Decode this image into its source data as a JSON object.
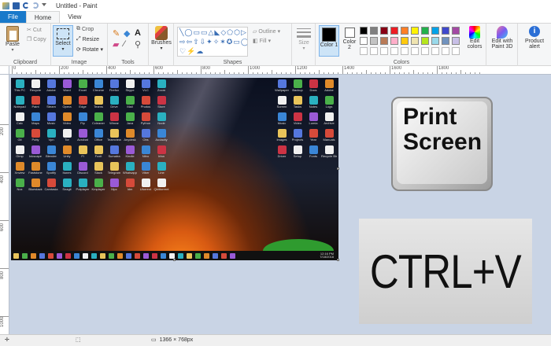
{
  "window": {
    "title": "Untitled - Paint"
  },
  "tabs": [
    "File",
    "Home",
    "View"
  ],
  "clipboard": {
    "paste": "Paste",
    "cut": "Cut",
    "copy": "Copy",
    "label": "Clipboard"
  },
  "image": {
    "select": "Select",
    "crop": "Crop",
    "resize": "Resize",
    "rotate": "Rotate",
    "label": "Image"
  },
  "tools": {
    "label": "Tools"
  },
  "brushes": {
    "label": "Brushes"
  },
  "shapes": {
    "outline": "Outline",
    "fill": "Fill",
    "label": "Shapes"
  },
  "size": {
    "label": "Size"
  },
  "colors": {
    "color1": "Color 1",
    "color2": "Color 2",
    "label": "Colors",
    "edit_colors": "Edit colors",
    "palette_row1": [
      "#000000",
      "#7f7f7f",
      "#880015",
      "#ed1c24",
      "#ff7f27",
      "#fff200",
      "#22b14c",
      "#00a2e8",
      "#3f48cc",
      "#a349a4"
    ],
    "palette_row2": [
      "#ffffff",
      "#c3c3c3",
      "#b97a57",
      "#ffaec9",
      "#ffc90e",
      "#efe4b0",
      "#b5e61d",
      "#99d9ea",
      "#7092be",
      "#c8bfe7"
    ],
    "color1_value": "#000000",
    "color2_value": "#ffffff"
  },
  "paint3d": {
    "label": "Edit with Paint 3D"
  },
  "product_alert": {
    "label": "Product alert"
  },
  "ruler": {
    "top": [
      "0",
      "200",
      "400",
      "600",
      "800",
      "1000",
      "1200",
      "1400",
      "1600",
      "1800"
    ],
    "left": [
      "200",
      "400",
      "600",
      "800",
      "1000"
    ]
  },
  "desktop": {
    "left_icons": [
      "This PC",
      "Recycle",
      "Adobe",
      "Word",
      "Excel",
      "Chrome",
      "Firefox",
      "Skype",
      "VLC",
      "Zoom",
      "Notepad",
      "Paint",
      "Steam",
      "Opera",
      "Edge",
      "Teams",
      "Drive",
      "Mail",
      "Photos",
      "Store",
      "Calc",
      "Maps",
      "Music",
      "Video",
      "Ftp",
      "Ccleaner",
      "Winrar",
      "Java",
      "Python",
      "Node",
      "Git",
      "Putty",
      "Vpn",
      "Tor",
      "Acrobat",
      "Office",
      "Teamview",
      "Anydesk",
      "Obs",
      "Audacity",
      "Gimp",
      "Inkscape",
      "Blender",
      "Unity",
      "Fl",
      "Foxit",
      "Sumatra",
      "Kindle",
      "Nitro",
      "Irfan",
      "Xnview",
      "Faststone",
      "Spotify",
      "Itunes",
      "Discord",
      "Slack",
      "Telegram",
      "Whatsapp",
      "Viber",
      "Line",
      "Nox",
      "Bluestack",
      "Camtasia",
      "Snagit",
      "Potplayer",
      "Kmplayer",
      "Mpc",
      "Idm",
      "Utorrent",
      "Qbittorrent"
    ],
    "right_icons": [
      "Wallpaper",
      "Backup",
      "Docs",
      "Adobe",
      "Screen",
      "Tasks",
      "Notes",
      "Logs",
      "Music",
      "Video",
      "Lumia",
      "Archive",
      "Images",
      "Projects",
      "Year",
      "Manuals",
      "Driver",
      "Setup",
      "Fonts",
      "Recycle Bin"
    ],
    "clock": "12:16 PM",
    "date": "7/18/2018"
  },
  "status": {
    "dimensions": "1366 × 768px"
  },
  "overlays": {
    "printscreen_line1": "Print",
    "printscreen_line2": "Screen",
    "ctrlv": "CTRL+V"
  }
}
